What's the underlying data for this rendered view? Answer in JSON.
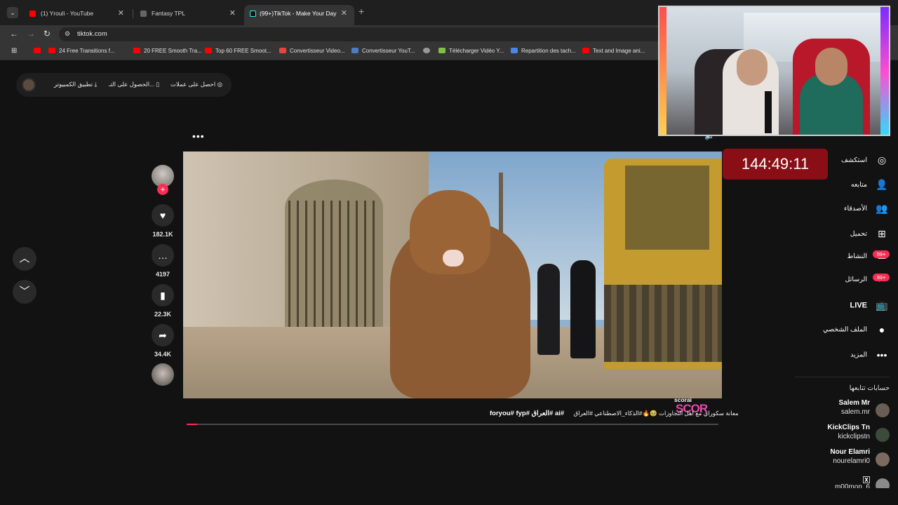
{
  "browser": {
    "tabs": [
      {
        "title": "(1) Yrouli - YouTube",
        "favicon": "youtube-icon",
        "active": false
      },
      {
        "title": "Fantasy TPL",
        "favicon": "page-icon",
        "active": false
      },
      {
        "title": "(99+)TikTok - Make Your Day",
        "favicon": "tiktok-icon",
        "active": true
      }
    ],
    "url": "tiktok.com",
    "bookmarks": [
      {
        "label": "",
        "icon": "youtube-icon"
      },
      {
        "label": "24 Free Transitions f...",
        "icon": "youtube-icon"
      },
      {
        "label": "20 FREE Smooth Tra...",
        "icon": "youtube-icon"
      },
      {
        "label": "Top 60 FREE Smoot...",
        "icon": "youtube-icon"
      },
      {
        "label": "Convertisseur Video...",
        "icon": "z-icon"
      },
      {
        "label": "Convertisseur YouT...",
        "icon": "converter-icon"
      },
      {
        "label": "",
        "icon": "globe-icon"
      },
      {
        "label": "Télécharger Vidéo Y...",
        "icon": "download-icon"
      },
      {
        "label": "Repartition des tach...",
        "icon": "docs-icon"
      },
      {
        "label": "Text and Image ani...",
        "icon": "youtube-icon"
      }
    ]
  },
  "top_pill": {
    "get_coins": "احصل على عملات",
    "get_app": "الحصول على التـ...",
    "desktop_app": "تطبيق الكمبيوتر"
  },
  "video": {
    "more": "•••",
    "watermark_user": "scorai",
    "watermark_logo": "SCOR",
    "caption_ar": "معانة سكوراي مع اهل التجاوزات 🥹🔥#الذكاء_الاصطناعي #العراق",
    "caption_tags": "foryou# fyp# العراق# ai#",
    "progress": 0.02
  },
  "actions": {
    "likes": "182.1K",
    "comments": "4197",
    "saves": "22.3K",
    "shares": "34.4K"
  },
  "timer": "144:49:11",
  "sidebar": {
    "items": [
      {
        "label": "استكشف",
        "icon": "compass-icon"
      },
      {
        "label": "متابعه",
        "icon": "following-icon"
      },
      {
        "label": "الأصدقاء",
        "icon": "friends-icon"
      },
      {
        "label": "تحميل",
        "icon": "upload-icon"
      },
      {
        "label": "النشاط",
        "icon": "activity-icon",
        "badge": "99+"
      },
      {
        "label": "الرسائل",
        "icon": "messages-icon",
        "badge": "99+"
      },
      {
        "label": "LIVE",
        "icon": "live-icon"
      },
      {
        "label": "الملف الشخصي",
        "icon": "profile-icon"
      },
      {
        "label": "المزيد",
        "icon": "more-icon"
      }
    ],
    "following_heading": "حسابات تتابعها",
    "accounts": [
      {
        "name": "Salem Mr",
        "username": "salem.mr"
      },
      {
        "name": "KickClips Tn",
        "username": "kickclipstn"
      },
      {
        "name": "Nour Elamri",
        "username": "nourelamri0"
      },
      {
        "name": "🅇",
        "username": "m00mon_6"
      }
    ]
  },
  "colors": {
    "accent": "#fe2c55",
    "timer_bg": "#8a0e16",
    "page_bg": "#121212"
  }
}
